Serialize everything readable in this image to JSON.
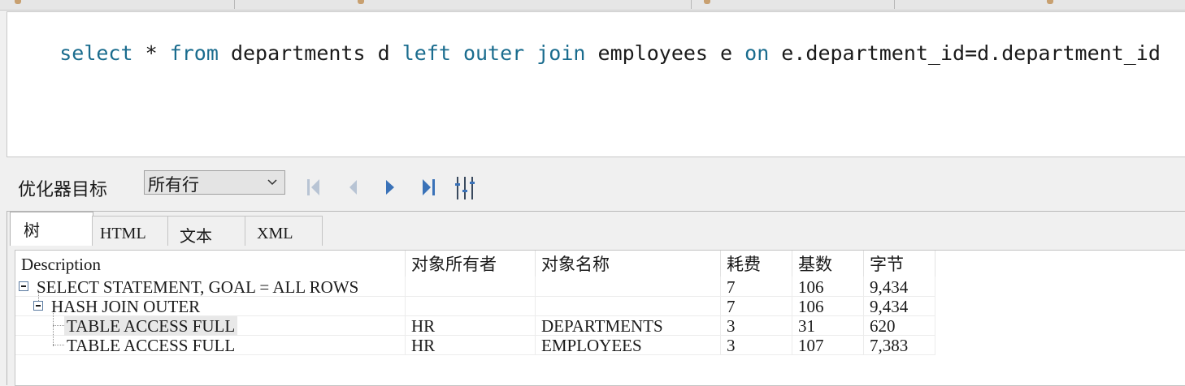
{
  "sql": {
    "tokens": [
      {
        "text": "select",
        "kw": true
      },
      {
        "text": " * ",
        "kw": false
      },
      {
        "text": "from",
        "kw": true
      },
      {
        "text": " departments d ",
        "kw": false
      },
      {
        "text": "left outer join",
        "kw": true
      },
      {
        "text": " employees e ",
        "kw": false
      },
      {
        "text": "on",
        "kw": true
      },
      {
        "text": " e.department_id=d.department_id",
        "kw": false
      }
    ]
  },
  "optimizer": {
    "label": "优化器目标",
    "selected": "所有行"
  },
  "result_tabs": [
    {
      "label": "树",
      "active": true
    },
    {
      "label": "HTML",
      "active": false
    },
    {
      "label": "文本",
      "active": false
    },
    {
      "label": "XML",
      "active": false
    }
  ],
  "grid": {
    "columns": [
      "Description",
      "对象所有者",
      "对象名称",
      "耗费",
      "基数",
      "字节"
    ],
    "rows": [
      {
        "description": "SELECT STATEMENT, GOAL = ALL ROWS",
        "owner": "",
        "object": "",
        "cost": "7",
        "cardinality": "106",
        "bytes": "9,434"
      },
      {
        "description": "HASH JOIN OUTER",
        "owner": "",
        "object": "",
        "cost": "7",
        "cardinality": "106",
        "bytes": "9,434"
      },
      {
        "description": "TABLE ACCESS FULL",
        "owner": "HR",
        "object": "DEPARTMENTS",
        "cost": "3",
        "cardinality": "31",
        "bytes": "620"
      },
      {
        "description": "TABLE ACCESS FULL",
        "owner": "HR",
        "object": "EMPLOYEES",
        "cost": "3",
        "cardinality": "107",
        "bytes": "7,383"
      }
    ]
  },
  "icons": {
    "nav": [
      "first-icon",
      "previous-icon",
      "next-icon",
      "last-icon",
      "columns-icon"
    ],
    "nav_color": "#4a7ab8",
    "keyword_color": "#1a6c8e"
  }
}
